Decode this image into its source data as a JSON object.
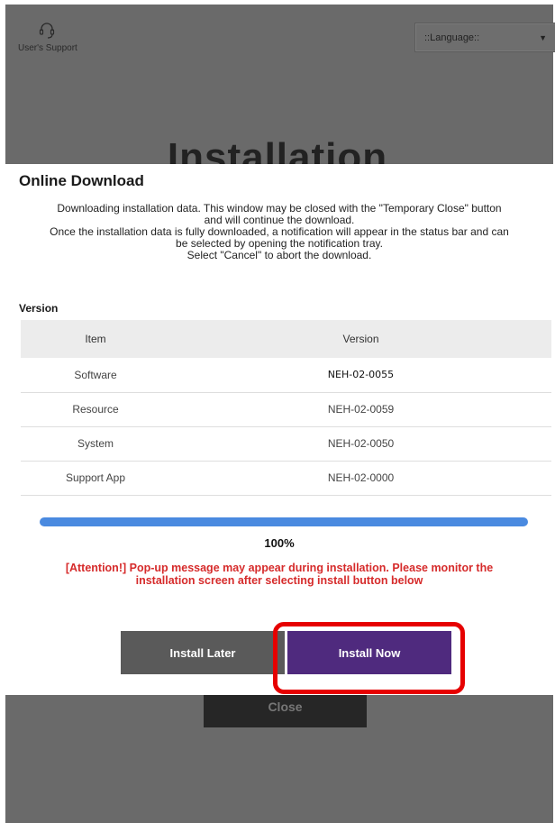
{
  "header": {
    "support_label": "User's Support",
    "support_icon": "headset-icon",
    "language_placeholder": "::Language::"
  },
  "background": {
    "title": "Installation",
    "close_label": "Close"
  },
  "dialog": {
    "title": "Online Download",
    "message_lines": [
      "Downloading installation data. This window may be closed with the \"Temporary Close\" button",
      "and will continue the download.",
      "Once the installation data is fully downloaded, a notification will appear in the status bar and can",
      "be selected by opening the notification tray.",
      "Select \"Cancel\" to abort the download."
    ],
    "version_section_label": "Version",
    "table": {
      "headers": [
        "Item",
        "Version"
      ],
      "rows": [
        [
          "Software",
          "NEH-02-0055"
        ],
        [
          "Resource",
          "NEH-02-0059"
        ],
        [
          "System",
          "NEH-02-0050"
        ],
        [
          "Support App",
          "NEH-02-0000"
        ]
      ]
    },
    "progress": {
      "value": 100,
      "label": "100%"
    },
    "attention_lines": [
      "[Attention!] Pop-up message may appear during installation. Please monitor the",
      "installation screen after selecting install button below"
    ],
    "buttons": {
      "install_later": "Install Later",
      "install_now": "Install Now"
    }
  },
  "colors": {
    "install_now_bg": "#4f2a7e",
    "install_later_bg": "#5a5a5a",
    "attention_text": "#d62b2b",
    "progress_fill": "#4a8ae0",
    "highlight_border": "#e60000"
  }
}
